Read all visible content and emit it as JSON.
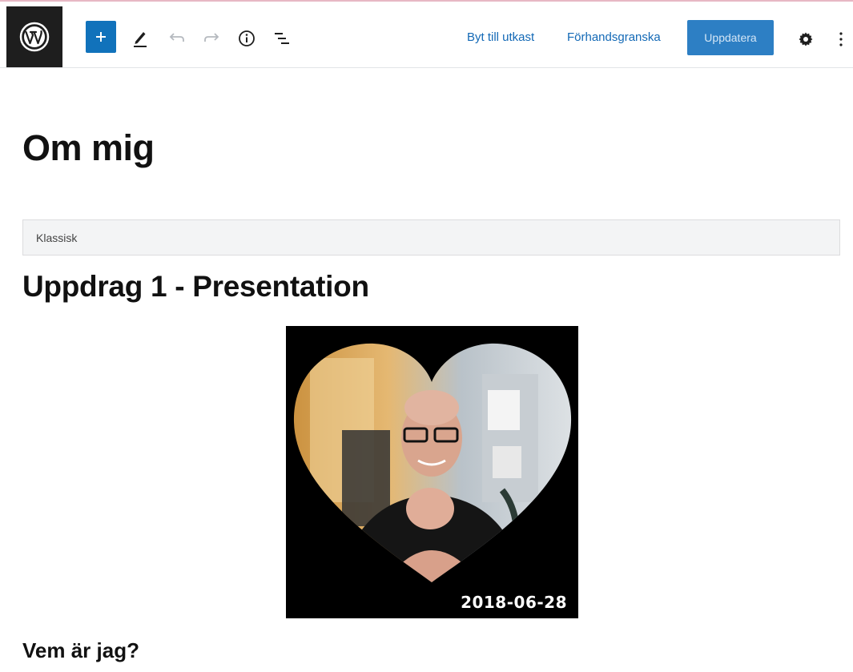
{
  "toolbar": {
    "logo": "wordpress-icon",
    "add_block": "+",
    "tools": [
      "pencil-icon",
      "undo-icon",
      "redo-icon",
      "info-icon",
      "list-view-icon"
    ],
    "switch_to_draft": "Byt till utkast",
    "preview": "Förhandsgranska",
    "update": "Uppdatera",
    "settings_icon": "gear-icon",
    "more_icon": "more-vertical-icon"
  },
  "editor": {
    "page_title": "Om mig",
    "classic_block_label": "Klassisk",
    "heading": "Uppdrag 1 - Presentation",
    "image_date": "2018-06-28",
    "subheading": "Vem är jag?"
  },
  "colors": {
    "accent": "#1172bb",
    "link": "#1369b6",
    "logo_bg": "#1e1e1e"
  }
}
